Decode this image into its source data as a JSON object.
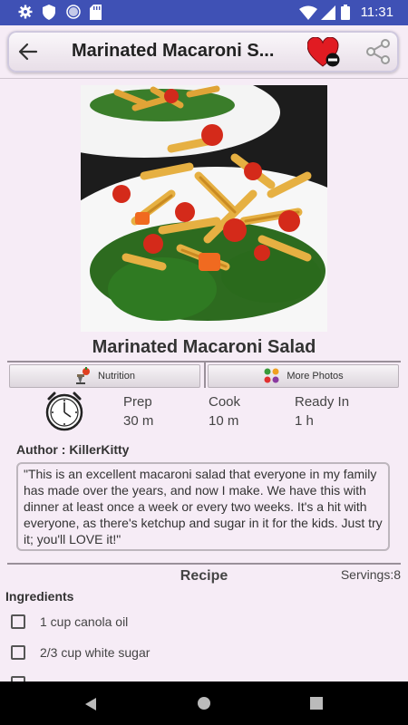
{
  "status_bar": {
    "time": "11:31",
    "icons": [
      "gear-icon",
      "shield-icon",
      "circle-icon",
      "sdcard-icon",
      "wifi-icon",
      "signal-icon",
      "battery-icon"
    ]
  },
  "toolbar": {
    "title": "Marinated Macaroni S...",
    "back_icon": "arrow-left-icon",
    "favorite_icon": "heart-minus-icon",
    "share_icon": "share-icon"
  },
  "recipe": {
    "title": "Marinated Macaroni Salad",
    "nutrition_label": "Nutrition",
    "more_photos_label": "More Photos",
    "times": [
      {
        "label": "Prep",
        "value": "30 m"
      },
      {
        "label": "Cook",
        "value": "10 m"
      },
      {
        "label": "Ready In",
        "value": "1 h"
      }
    ],
    "author": "Author : KillerKitty",
    "description": "\"This is an excellent macaroni salad that everyone in my family has made over the years, and now I make. We have this with dinner at least once a week or every two weeks. It's a hit with everyone, as there's ketchup and sugar  in it for the kids. Just try it; you'll LOVE it!\"",
    "section_title": "Recipe",
    "servings": "Servings:8",
    "ingredients_title": "Ingredients",
    "ingredients": [
      "1 cup canola oil",
      "2/3 cup white sugar"
    ]
  },
  "colors": {
    "status_bar": "#3f51b5",
    "background": "#f6ecf6",
    "heart": "#e11b22"
  }
}
